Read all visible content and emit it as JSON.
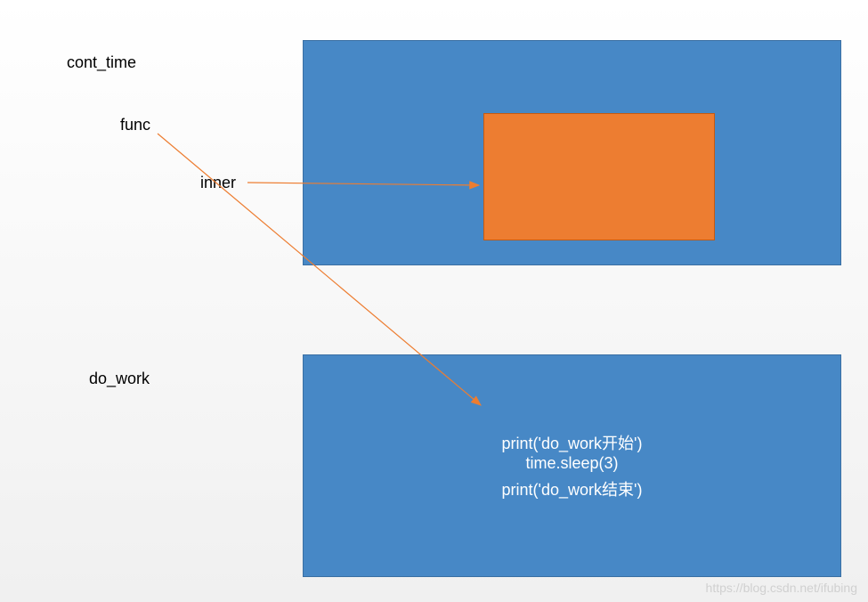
{
  "labels": {
    "cont_time": "cont_time",
    "func": "func",
    "inner": "inner",
    "do_work": "do_work"
  },
  "code": {
    "line1": "print('do_work开始')",
    "line2": "time.sleep(3)",
    "line3": "print('do_work结束')"
  },
  "watermark": "https://blog.csdn.net/ifubing",
  "colors": {
    "blue_box": "#4788c6",
    "orange_box": "#ed7d31",
    "arrow": "#ed7d31"
  },
  "diagram": {
    "description": "Python decorator closure diagram showing cont_time wrapping func with inner closure, and do_work function body",
    "arrows": [
      {
        "from": "inner",
        "to": "orange_inner_box"
      },
      {
        "from": "func",
        "to": "blue_bottom_box"
      }
    ]
  }
}
